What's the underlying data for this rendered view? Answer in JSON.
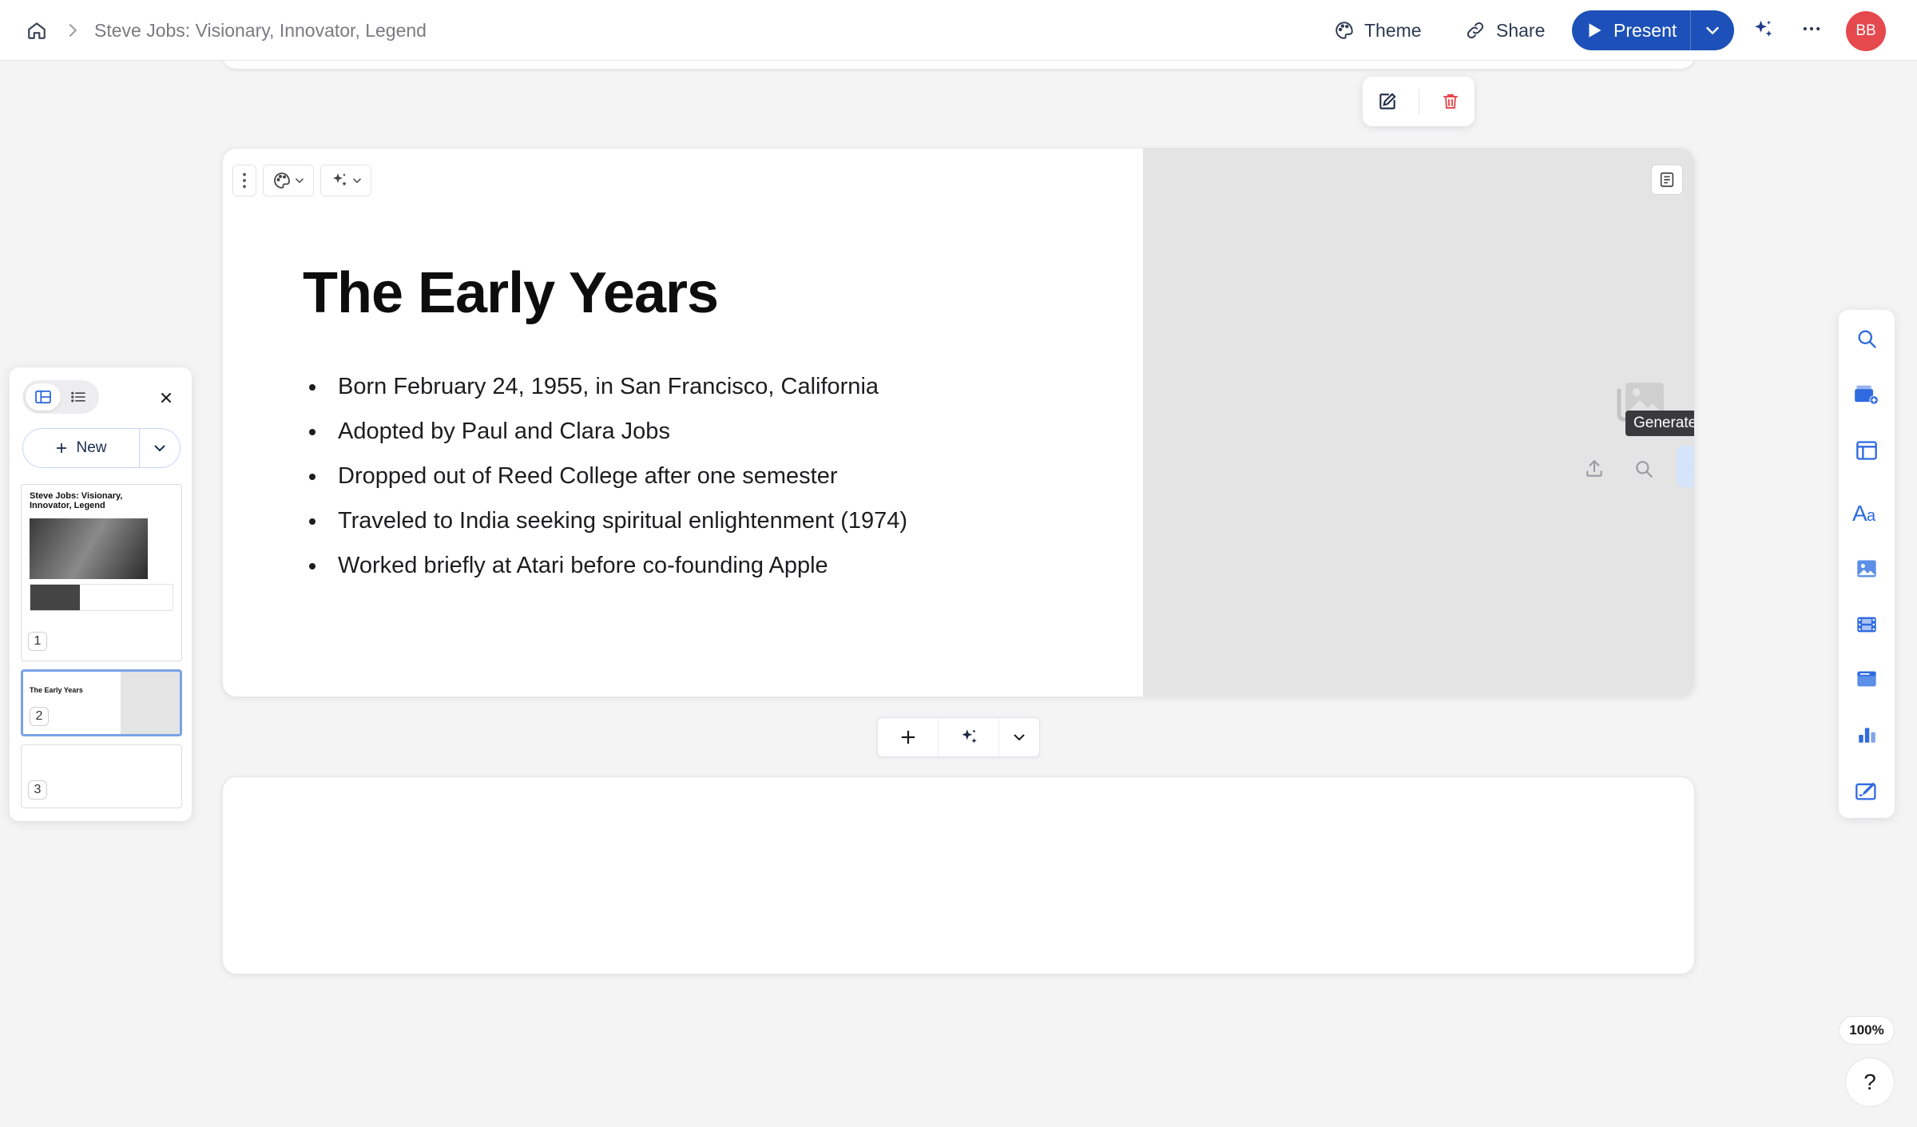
{
  "header": {
    "breadcrumb_title": "Steve Jobs: Visionary, Innovator, Legend",
    "theme_label": "Theme",
    "share_label": "Share",
    "present_label": "Present",
    "avatar_initials": "BB"
  },
  "slide": {
    "title": "The Early Years",
    "bullets": [
      "Born February 24, 1955, in San Francisco, California",
      "Adopted by Paul and Clara Jobs",
      "Dropped out of Reed College after one semester",
      "Traveled to India seeking spiritual enlightenment (1974)",
      "Worked briefly at Atari before co-founding Apple"
    ],
    "image_tooltip": "Generate image"
  },
  "left_panel": {
    "new_label": "New",
    "thumbnails": [
      {
        "number": "1",
        "title": "Steve Jobs: Visionary, Innovator, Legend"
      },
      {
        "number": "2",
        "title": "The Early Years"
      },
      {
        "number": "3",
        "title": ""
      }
    ]
  },
  "right_rail": {
    "icons": [
      "search-icon",
      "add-card-icon",
      "layout-icon",
      "text-styles-icon",
      "image-icon",
      "video-icon",
      "embed-icon",
      "chart-icon",
      "draw-icon"
    ]
  },
  "footer": {
    "zoom": "100%",
    "help": "?"
  },
  "colors": {
    "accent": "#1d50b8",
    "avatar": "#e5484d",
    "icon_blue": "#2f6ae0",
    "delete_red": "#e5484d"
  }
}
